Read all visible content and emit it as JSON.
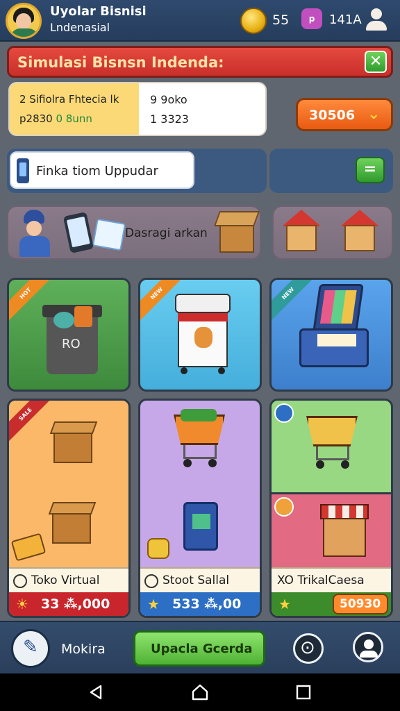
{
  "header": {
    "title": "Uyolar Bisnisi",
    "subtitle": "Lndenasial",
    "coins": "55",
    "gems": "141A",
    "gem_label": "p"
  },
  "banner": {
    "title": "Simulasi Bisnsn Indenda:",
    "close_label": "✕"
  },
  "stats": {
    "line1": "2 Sifiolra Fhtecia lk",
    "line2_prefix": "p2830",
    "line2_green": "0 8unn",
    "right1": "9 9oko",
    "right2": "1 3323"
  },
  "currency_button": {
    "label": "30506",
    "chevron": "⌄"
  },
  "search": {
    "text": "Finka tiom Uppudar",
    "side_button": "="
  },
  "promo": {
    "text": "Dasragi arkan"
  },
  "tiles": [
    {
      "ribbon": "HOT",
      "label": "RO"
    },
    {
      "ribbon": "NEW"
    },
    {
      "ribbon": "NEW"
    }
  ],
  "shops": [
    {
      "name": "Toko Virtual",
      "price": "33 ⁂,000",
      "ribbon": "SALE",
      "price_icon": "☀"
    },
    {
      "name": "Stoot Sallal",
      "price": "533 ⁂,00",
      "price_icon": "★"
    },
    {
      "name": "TrikalCaesa",
      "price": "50930",
      "price_icon": "★",
      "prefix": "XO"
    }
  ],
  "bottom": {
    "sync_label": "Mokira",
    "update_label": "Upacla Gcerda"
  }
}
